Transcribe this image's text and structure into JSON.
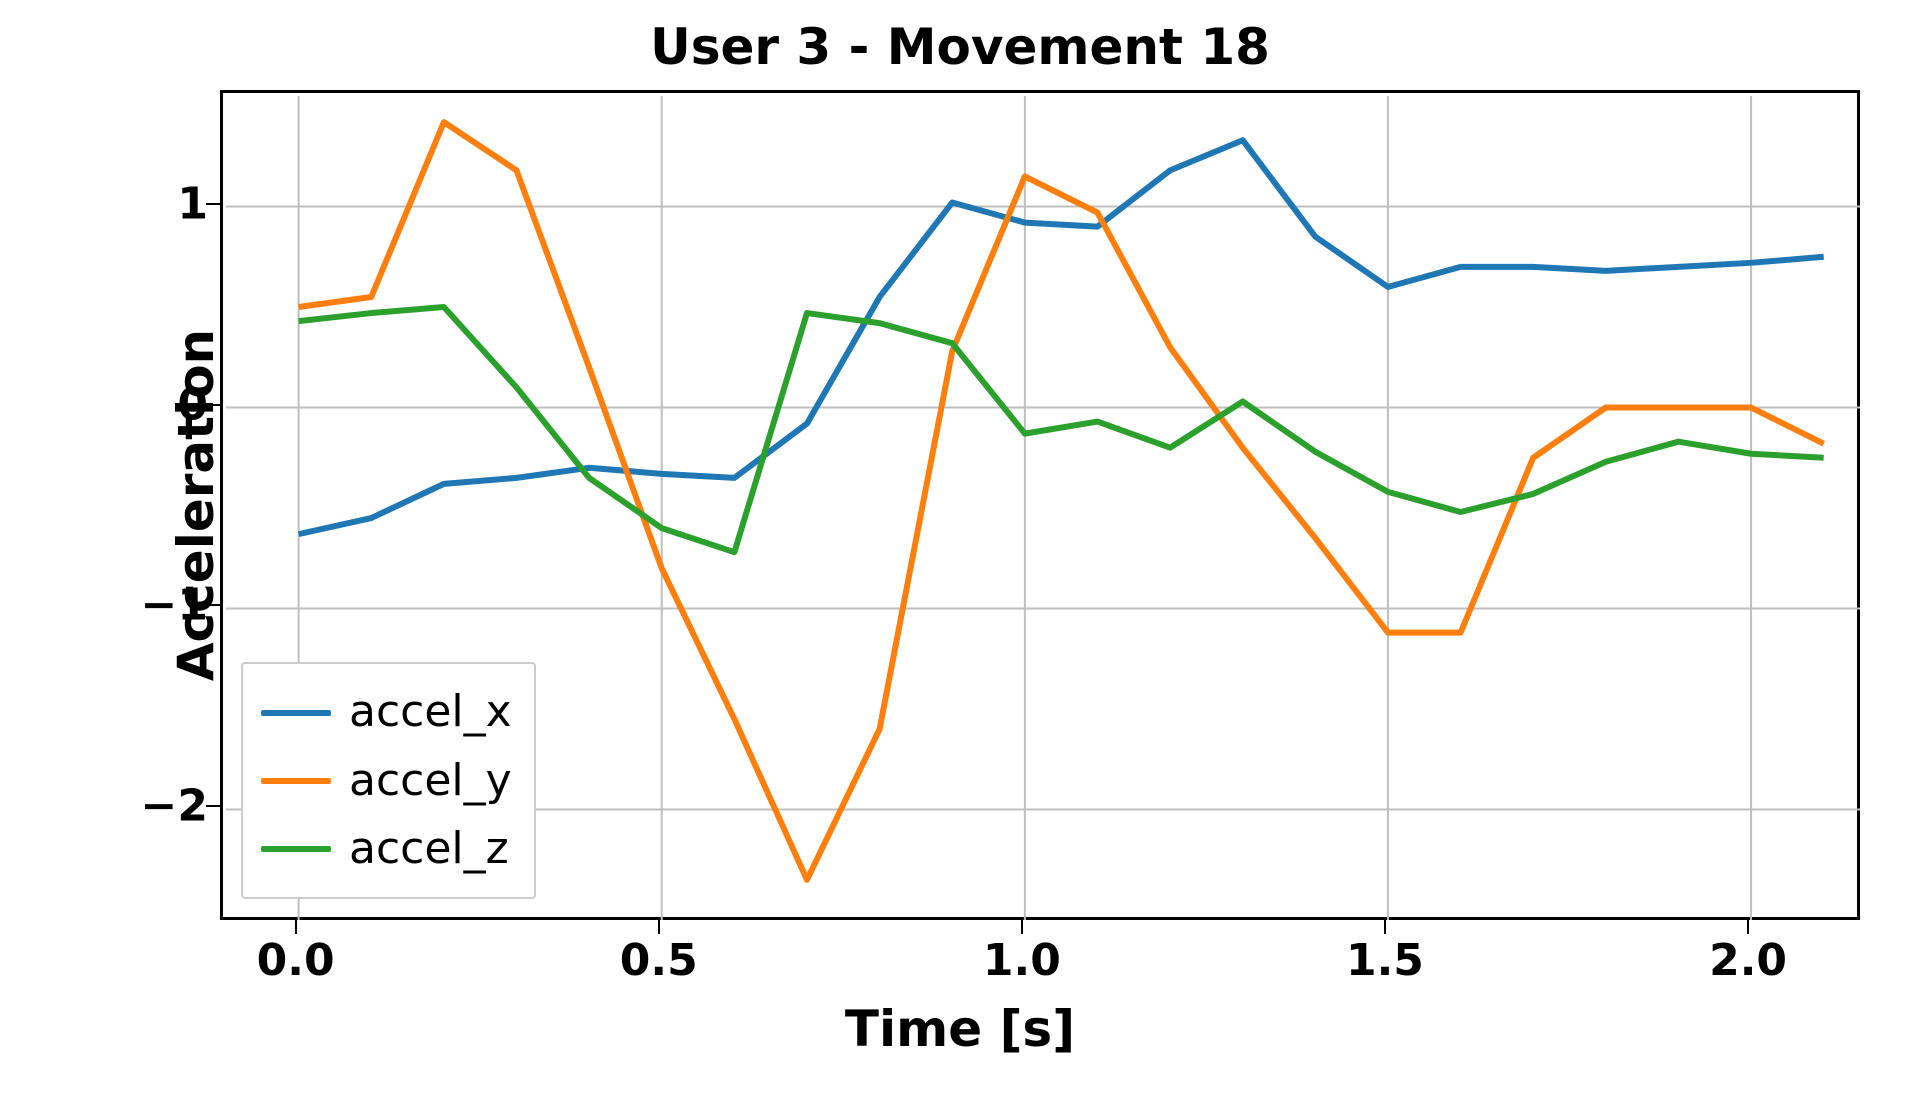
{
  "chart_data": {
    "type": "line",
    "title": "User 3 - Movement 18",
    "xlabel": "Time [s]",
    "ylabel": "Acceleration",
    "xlim": [
      -0.1,
      2.15
    ],
    "ylim": [
      -2.55,
      1.55
    ],
    "x_ticks": [
      0.0,
      0.5,
      1.0,
      1.5,
      2.0
    ],
    "x_tick_labels": [
      "0.0",
      "0.5",
      "1.0",
      "1.5",
      "2.0"
    ],
    "y_ticks": [
      -2,
      -1,
      0,
      1
    ],
    "y_tick_labels": [
      "−2",
      "−1",
      "0",
      "1"
    ],
    "x": [
      0.0,
      0.1,
      0.2,
      0.3,
      0.4,
      0.5,
      0.6,
      0.7,
      0.8,
      0.9,
      1.0,
      1.1,
      1.2,
      1.3,
      1.4,
      1.5,
      1.6,
      1.7,
      1.8,
      1.9,
      2.0,
      2.1
    ],
    "series": [
      {
        "name": "accel_x",
        "color": "#1f77b4",
        "values": [
          -0.63,
          -0.55,
          -0.38,
          -0.35,
          -0.3,
          -0.33,
          -0.35,
          -0.08,
          0.55,
          1.02,
          0.92,
          0.9,
          1.18,
          1.33,
          0.85,
          0.6,
          0.7,
          0.7,
          0.68,
          0.7,
          0.72,
          0.75
        ]
      },
      {
        "name": "accel_y",
        "color": "#ff7f0e",
        "values": [
          0.5,
          0.55,
          1.42,
          1.18,
          0.2,
          -0.8,
          -1.55,
          -2.35,
          -1.6,
          0.28,
          1.15,
          0.97,
          0.3,
          -0.2,
          -0.65,
          -1.12,
          -1.12,
          -0.25,
          0.0,
          0.0,
          0.0,
          -0.18
        ]
      },
      {
        "name": "accel_z",
        "color": "#2ca02c",
        "values": [
          0.43,
          0.47,
          0.5,
          0.1,
          -0.35,
          -0.6,
          -0.72,
          0.47,
          0.42,
          0.32,
          -0.13,
          -0.07,
          -0.2,
          0.03,
          -0.22,
          -0.42,
          -0.52,
          -0.43,
          -0.27,
          -0.17,
          -0.23,
          -0.25
        ]
      }
    ],
    "legend_position": "lower left"
  }
}
